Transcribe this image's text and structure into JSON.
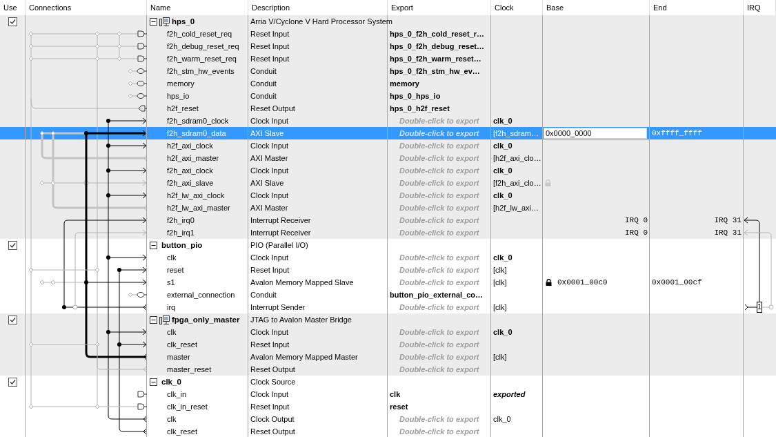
{
  "columns": [
    "Use",
    "Connections",
    "Name",
    "Description",
    "Export",
    "Clock",
    "Base",
    "End",
    "IRQ"
  ],
  "modules": [
    {
      "name": "hps_0",
      "description": "Arria V/Cyclone V Hard Processor System",
      "use": true,
      "expanded": true,
      "icon": true,
      "selected": false,
      "ports": [
        {
          "name": "f2h_cold_reset_req",
          "description": "Reset Input",
          "export": "hps_0_f2h_cold_reset_r…",
          "exported": true,
          "selected": false
        },
        {
          "name": "f2h_debug_reset_req",
          "description": "Reset Input",
          "export": "hps_0_f2h_debug_reset…",
          "exported": true,
          "selected": false
        },
        {
          "name": "f2h_warm_reset_req",
          "description": "Reset Input",
          "export": "hps_0_f2h_warm_reset…",
          "exported": true,
          "selected": false
        },
        {
          "name": "f2h_stm_hw_events",
          "description": "Conduit",
          "export": "hps_0_f2h_stm_hw_ev…",
          "exported": true,
          "selected": false
        },
        {
          "name": "memory",
          "description": "Conduit",
          "export": "memory",
          "exported": true,
          "selected": false
        },
        {
          "name": "hps_io",
          "description": "Conduit",
          "export": "hps_0_hps_io",
          "exported": true,
          "selected": false
        },
        {
          "name": "h2f_reset",
          "description": "Reset Output",
          "export": "hps_0_h2f_reset",
          "exported": true,
          "selected": false
        },
        {
          "name": "f2h_sdram0_clock",
          "description": "Clock Input",
          "export": "Double-click to export",
          "exported": false,
          "clock": "clk_0",
          "clock_bold": true,
          "clock_italic": false,
          "selected": false
        },
        {
          "name": "f2h_sdram0_data",
          "description": "AXI Slave",
          "export": "Double-click to export",
          "exported": false,
          "clock": "[f2h_sdram…",
          "clock_bold": false,
          "clock_italic": false,
          "base": "0x0000_0000",
          "end": "0xffff_ffff",
          "irq_range": false,
          "selected": true
        },
        {
          "name": "h2f_axi_clock",
          "description": "Clock Input",
          "export": "Double-click to export",
          "exported": false,
          "clock": "clk_0",
          "clock_bold": true,
          "clock_italic": false,
          "selected": false
        },
        {
          "name": "h2f_axi_master",
          "description": "AXI Master",
          "export": "Double-click to export",
          "exported": false,
          "clock": "[h2f_axi_clo…",
          "clock_bold": false,
          "clock_italic": false,
          "selected": false
        },
        {
          "name": "f2h_axi_clock",
          "description": "Clock Input",
          "export": "Double-click to export",
          "exported": false,
          "clock": "clk_0",
          "clock_bold": true,
          "clock_italic": false,
          "selected": false
        },
        {
          "name": "f2h_axi_slave",
          "description": "AXI Slave",
          "export": "Double-click to export",
          "exported": false,
          "clock": "[f2h_axi_clo…",
          "clock_bold": false,
          "clock_italic": false,
          "locked": true,
          "lock_dimmed": true,
          "selected": false
        },
        {
          "name": "h2f_lw_axi_clock",
          "description": "Clock Input",
          "export": "Double-click to export",
          "exported": false,
          "clock": "clk_0",
          "clock_bold": true,
          "clock_italic": false,
          "selected": false
        },
        {
          "name": "h2f_lw_axi_master",
          "description": "AXI Master",
          "export": "Double-click to export",
          "exported": false,
          "clock": "[h2f_lw_axi…",
          "clock_bold": false,
          "clock_italic": false,
          "selected": false
        },
        {
          "name": "f2h_irq0",
          "description": "Interrupt Receiver",
          "export": "Double-click to export",
          "exported": false,
          "base": "IRQ 0",
          "end": "IRQ 31",
          "irq_range": true,
          "selected": false
        },
        {
          "name": "f2h_irq1",
          "description": "Interrupt Receiver",
          "export": "Double-click to export",
          "exported": false,
          "base": "IRQ 0",
          "end": "IRQ 31",
          "irq_range": true,
          "selected": false
        }
      ]
    },
    {
      "name": "button_pio",
      "description": "PIO (Parallel I/O)",
      "use": true,
      "expanded": true,
      "icon": false,
      "selected": false,
      "ports": [
        {
          "name": "clk",
          "description": "Clock Input",
          "export": "Double-click to export",
          "exported": false,
          "clock": "clk_0",
          "clock_bold": true,
          "clock_italic": false,
          "selected": false
        },
        {
          "name": "reset",
          "description": "Reset Input",
          "export": "Double-click to export",
          "exported": false,
          "clock": "[clk]",
          "clock_bold": false,
          "clock_italic": false,
          "selected": false
        },
        {
          "name": "s1",
          "description": "Avalon Memory Mapped Slave",
          "export": "Double-click to export",
          "exported": false,
          "clock": "[clk]",
          "clock_bold": false,
          "clock_italic": false,
          "base": "0x0001_00c0",
          "end": "0x0001_00cf",
          "irq_range": false,
          "locked": true,
          "lock_dimmed": false,
          "selected": false
        },
        {
          "name": "external_connection",
          "description": "Conduit",
          "export": "button_pio_external_co…",
          "exported": true,
          "selected": false
        },
        {
          "name": "irq",
          "description": "Interrupt Sender",
          "export": "Double-click to export",
          "exported": false,
          "clock": "[clk]",
          "clock_bold": false,
          "clock_italic": false,
          "irq": "1",
          "selected": false
        }
      ]
    },
    {
      "name": "fpga_only_master",
      "description": "JTAG to Avalon Master Bridge",
      "use": true,
      "expanded": true,
      "icon": true,
      "selected": false,
      "ports": [
        {
          "name": "clk",
          "description": "Clock Input",
          "export": "Double-click to export",
          "exported": false,
          "clock": "clk_0",
          "clock_bold": true,
          "clock_italic": false,
          "selected": false
        },
        {
          "name": "clk_reset",
          "description": "Reset Input",
          "export": "Double-click to export",
          "exported": false,
          "selected": false
        },
        {
          "name": "master",
          "description": "Avalon Memory Mapped Master",
          "export": "Double-click to export",
          "exported": false,
          "clock": "[clk]",
          "clock_bold": false,
          "clock_italic": false,
          "selected": false
        },
        {
          "name": "master_reset",
          "description": "Reset Output",
          "export": "Double-click to export",
          "exported": false,
          "selected": false
        }
      ]
    },
    {
      "name": "clk_0",
      "description": "Clock Source",
      "use": true,
      "expanded": true,
      "icon": false,
      "selected": false,
      "ports": [
        {
          "name": "clk_in",
          "description": "Clock Input",
          "export": "clk",
          "exported": true,
          "clock": "exported",
          "clock_bold": true,
          "clock_italic": true,
          "selected": false
        },
        {
          "name": "clk_in_reset",
          "description": "Reset Input",
          "export": "reset",
          "exported": true,
          "selected": false
        },
        {
          "name": "clk",
          "description": "Clock Output",
          "export": "Double-click to export",
          "exported": false,
          "clock": "clk_0",
          "clock_bold": false,
          "clock_italic": false,
          "selected": false
        },
        {
          "name": "clk_reset",
          "description": "Reset Output",
          "export": "Double-click to export",
          "exported": false,
          "selected": false
        }
      ]
    }
  ]
}
